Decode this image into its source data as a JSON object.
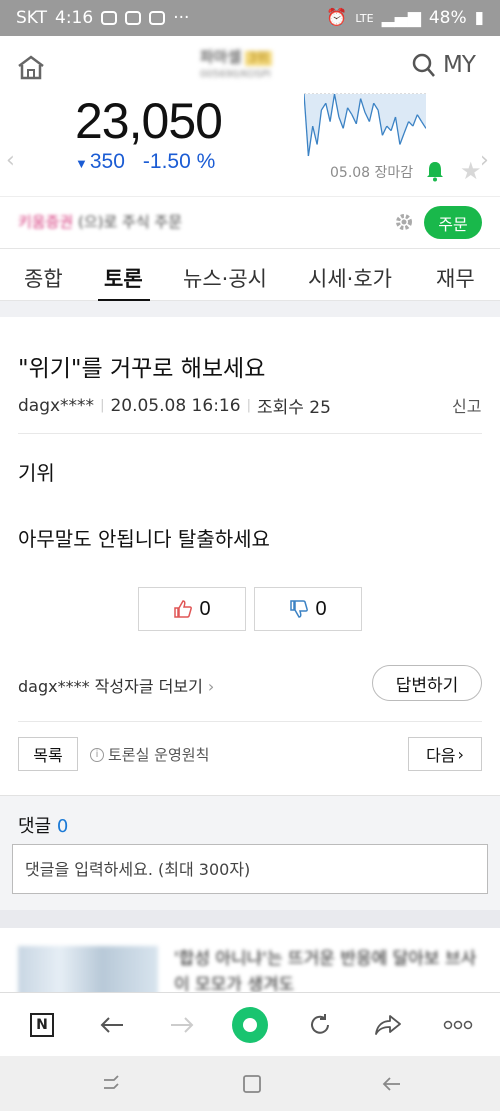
{
  "status_bar": {
    "carrier": "SKT",
    "time": "4:16",
    "signal": "LTE",
    "battery": "48%"
  },
  "stock": {
    "name": "파마셀",
    "badge": "3위",
    "code": "005690/KOSPI",
    "price": "23,050",
    "change": "350",
    "change_pct": "-1.50 %",
    "close_label": "05.08 장마감",
    "my_label": "MY",
    "mini_chart": {
      "type": "line",
      "values": [
        62,
        35,
        48,
        40,
        55,
        58,
        50,
        62,
        52,
        47,
        56,
        53,
        49,
        60,
        54,
        50,
        58,
        55,
        44,
        48,
        46,
        52,
        40,
        45,
        50,
        48,
        53,
        50,
        47
      ],
      "colors": {
        "above": "#e05656",
        "below": "#3b82c4",
        "fill": "#dce9f6"
      }
    }
  },
  "order": {
    "broker_text": "키움증권",
    "broker_suffix": "(으)로 주식 주문",
    "button": "주문"
  },
  "tabs": [
    {
      "label": "종합",
      "active": false
    },
    {
      "label": "토론",
      "active": true
    },
    {
      "label": "뉴스·공시",
      "active": false
    },
    {
      "label": "시세·호가",
      "active": false
    },
    {
      "label": "재무",
      "active": false
    }
  ],
  "post": {
    "title": "\"위기\"를 거꾸로 해보세요",
    "author": "dagx****",
    "datetime": "20.05.08 16:16",
    "views": "조회수 25",
    "report": "신고",
    "body_line1": "기위",
    "body_line2": "아무말도 안됩니다 탈출하세요",
    "likes": "0",
    "dislikes": "0",
    "more_by_author": "dagx**** 작성자글 더보기",
    "reply_button": "답변하기",
    "list_button": "목록",
    "rules_link": "토론실 운영원칙",
    "next_button": "다음"
  },
  "comments": {
    "label": "댓글",
    "count": "0",
    "placeholder": "댓글을 입력하세요. (최대 300자)"
  },
  "news": {
    "text": "'합성 아니냐'는 뜨거운 반응에 달아보 브사이 모모가 생겨도"
  },
  "browser_bar": {
    "logo": "N"
  }
}
